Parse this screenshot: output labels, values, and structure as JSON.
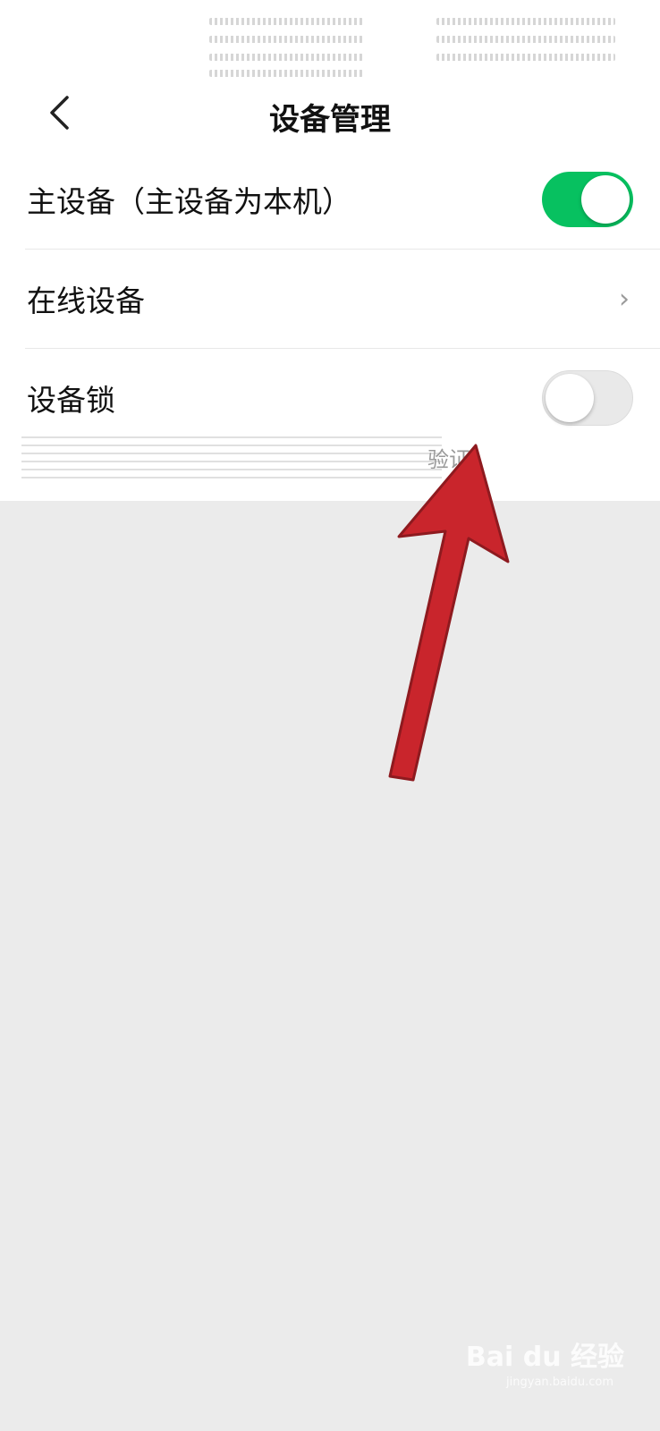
{
  "header": {
    "title": "设备管理",
    "back_icon": "chevron-left-icon"
  },
  "settings": {
    "rows": [
      {
        "label": "主设备（主设备为本机）",
        "type": "toggle",
        "checked": true
      },
      {
        "label": "在线设备",
        "type": "link",
        "chevron": "›"
      },
      {
        "label": "设备锁",
        "type": "toggle",
        "checked": false
      }
    ],
    "device_lock_desc_visible": "验证"
  },
  "colors": {
    "toggle_on": "#07c160",
    "toggle_off": "#e9e9e9",
    "page_bg": "#ebebeb",
    "arrow": "#c9252c"
  },
  "watermark": {
    "logo": "Bai du 经验",
    "url": "jingyan.baidu.com"
  }
}
